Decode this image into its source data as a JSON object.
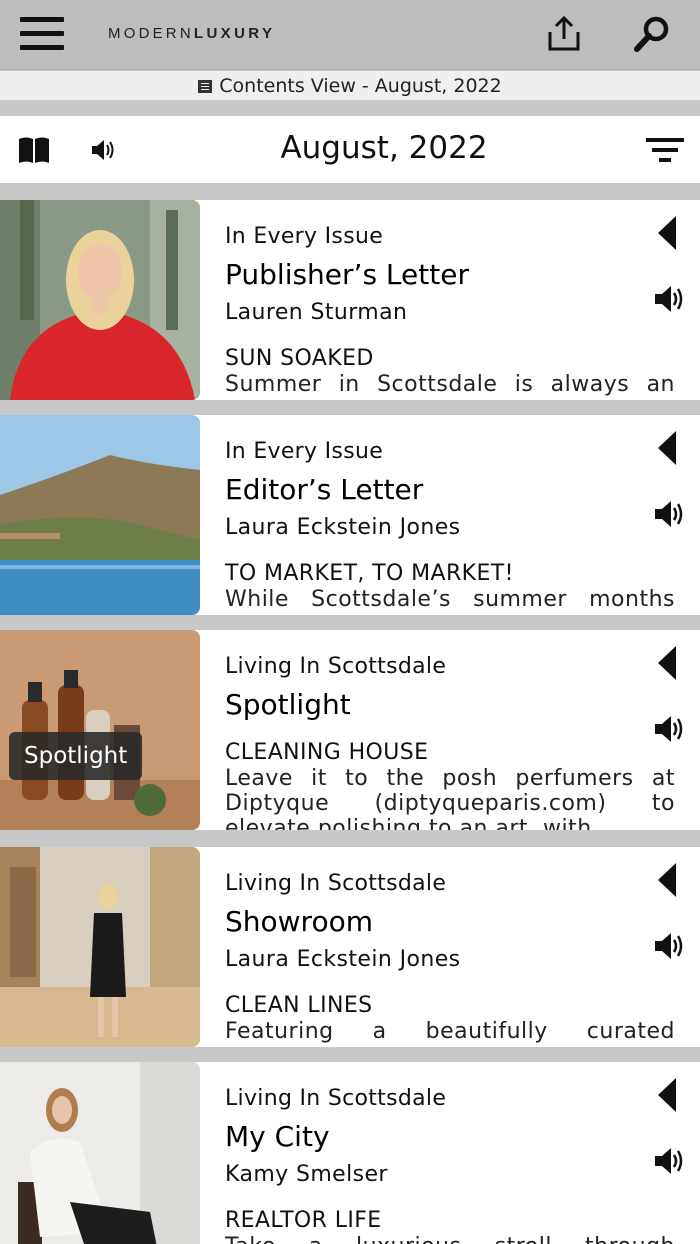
{
  "header": {
    "brand_light": "MODERN",
    "brand_bold": "LUXURY"
  },
  "contents_bar": {
    "label": "Contents View - August, 2022"
  },
  "issue": {
    "title": "August, 2022"
  },
  "articles": [
    {
      "section": "In Every Issue",
      "title": "Publisher’s Letter",
      "author": "Lauren Sturman",
      "headline": "SUN SOAKED",
      "excerpt": "Summer in Scottsdale is always an"
    },
    {
      "section": "In Every Issue",
      "title": "Editor’s Letter",
      "author": "Laura Eckstein Jones",
      "headline": "TO MARKET, TO MARKET!",
      "excerpt": "While Scottsdale’s summer months"
    },
    {
      "section": "Living In Scottsdale",
      "title": "Spotlight",
      "author": "",
      "headline": "CLEANING HOUSE",
      "excerpt": "Leave it to the posh perfumers at Diptyque (diptyqueparis.com) to elevate polishing to an art, with",
      "badge": "Spotlight"
    },
    {
      "section": "Living In Scottsdale",
      "title": "Showroom",
      "author": "Laura Eckstein Jones",
      "headline": "CLEAN LINES",
      "excerpt": "Featuring a beautifully curated"
    },
    {
      "section": "Living In Scottsdale",
      "title": "My City",
      "author": "Kamy Smelser",
      "headline": "REALTOR LIFE",
      "excerpt": "Take a luxurious stroll through"
    }
  ],
  "colors": {
    "app_bar": "#bdbdbd",
    "page_bg": "#c8c8c8",
    "card_bg": "#ffffff",
    "icon": "#111111"
  },
  "icons": {
    "menu": "hamburger-icon",
    "share": "share-icon",
    "search": "search-icon",
    "contents": "book-icon",
    "read": "open-book-icon",
    "audio": "speaker-icon",
    "filter": "filter-icon",
    "collapse": "triangle-left-icon"
  }
}
